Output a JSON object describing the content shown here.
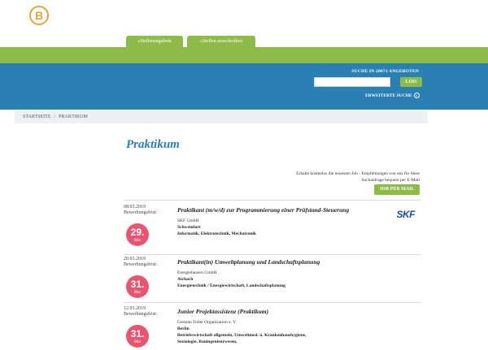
{
  "brand": {
    "logo_letter": "B",
    "accent_color": "#e9a23b"
  },
  "tabs": [
    {
      "label": "»Stellenangebote"
    },
    {
      "label": "»Stellen ausschreiben"
    }
  ],
  "search": {
    "label": "SUCHE IN 28071 ANGEBOTEN",
    "placeholder": "",
    "button_label": "LOS!",
    "advanced_label": "ERWEITERTE SUCHE"
  },
  "breadcrumb": {
    "home": "STARTSEITE",
    "separator": "/",
    "current": "PRAKTIKUM"
  },
  "page": {
    "title": "Praktikum",
    "mail_info": "Erhalte kostenlos die neuesten Job - Empfehlungen von uns für diese Suchanfrage bequem per E-Mail",
    "mail_button": "JOB PER MAIL"
  },
  "jobs": [
    {
      "date": "08.03.2019",
      "deadline_label": "Bewerbungsfrist:",
      "deadline_day": "29.",
      "deadline_month": "Mar",
      "title": "Praktikant (m/w/d) zur Programmierung einer Prüfstand-Steuerung",
      "company": "SKF GmbH",
      "city": "Schweinfurt",
      "categories": "Informatik, Elektrotechnik, Mechatronik",
      "logo_text": "SKF"
    },
    {
      "date": "20.03.2019",
      "deadline_label": "Bewerbungsfrist:",
      "deadline_day": "31.",
      "deadline_month": "Mar",
      "title": "Praktikant(in) Umweltplanung und Landschaftsplanung",
      "company": "Energiebauern GmbH",
      "city": "Aichach",
      "categories": "Energietechnik / Energiewirtschaft, Landschaftsplanung"
    },
    {
      "date": "12.03.2019",
      "deadline_label": "Bewerbungsfrist:",
      "deadline_day": "31.",
      "deadline_month": "Mar",
      "title": "Junior Projektassistenz (Praktikum)",
      "company": "German Toilet Organization e. V.",
      "city": "Berlin",
      "categories": "Betriebswirtschaft allgemein, Umweltmed. u. Krankenhaushygiene, Soziologie, Bauingenieurwesen,"
    }
  ],
  "colors": {
    "green": "#8dbb48",
    "blue": "#2a7fb3",
    "badge": "#e9556f"
  }
}
